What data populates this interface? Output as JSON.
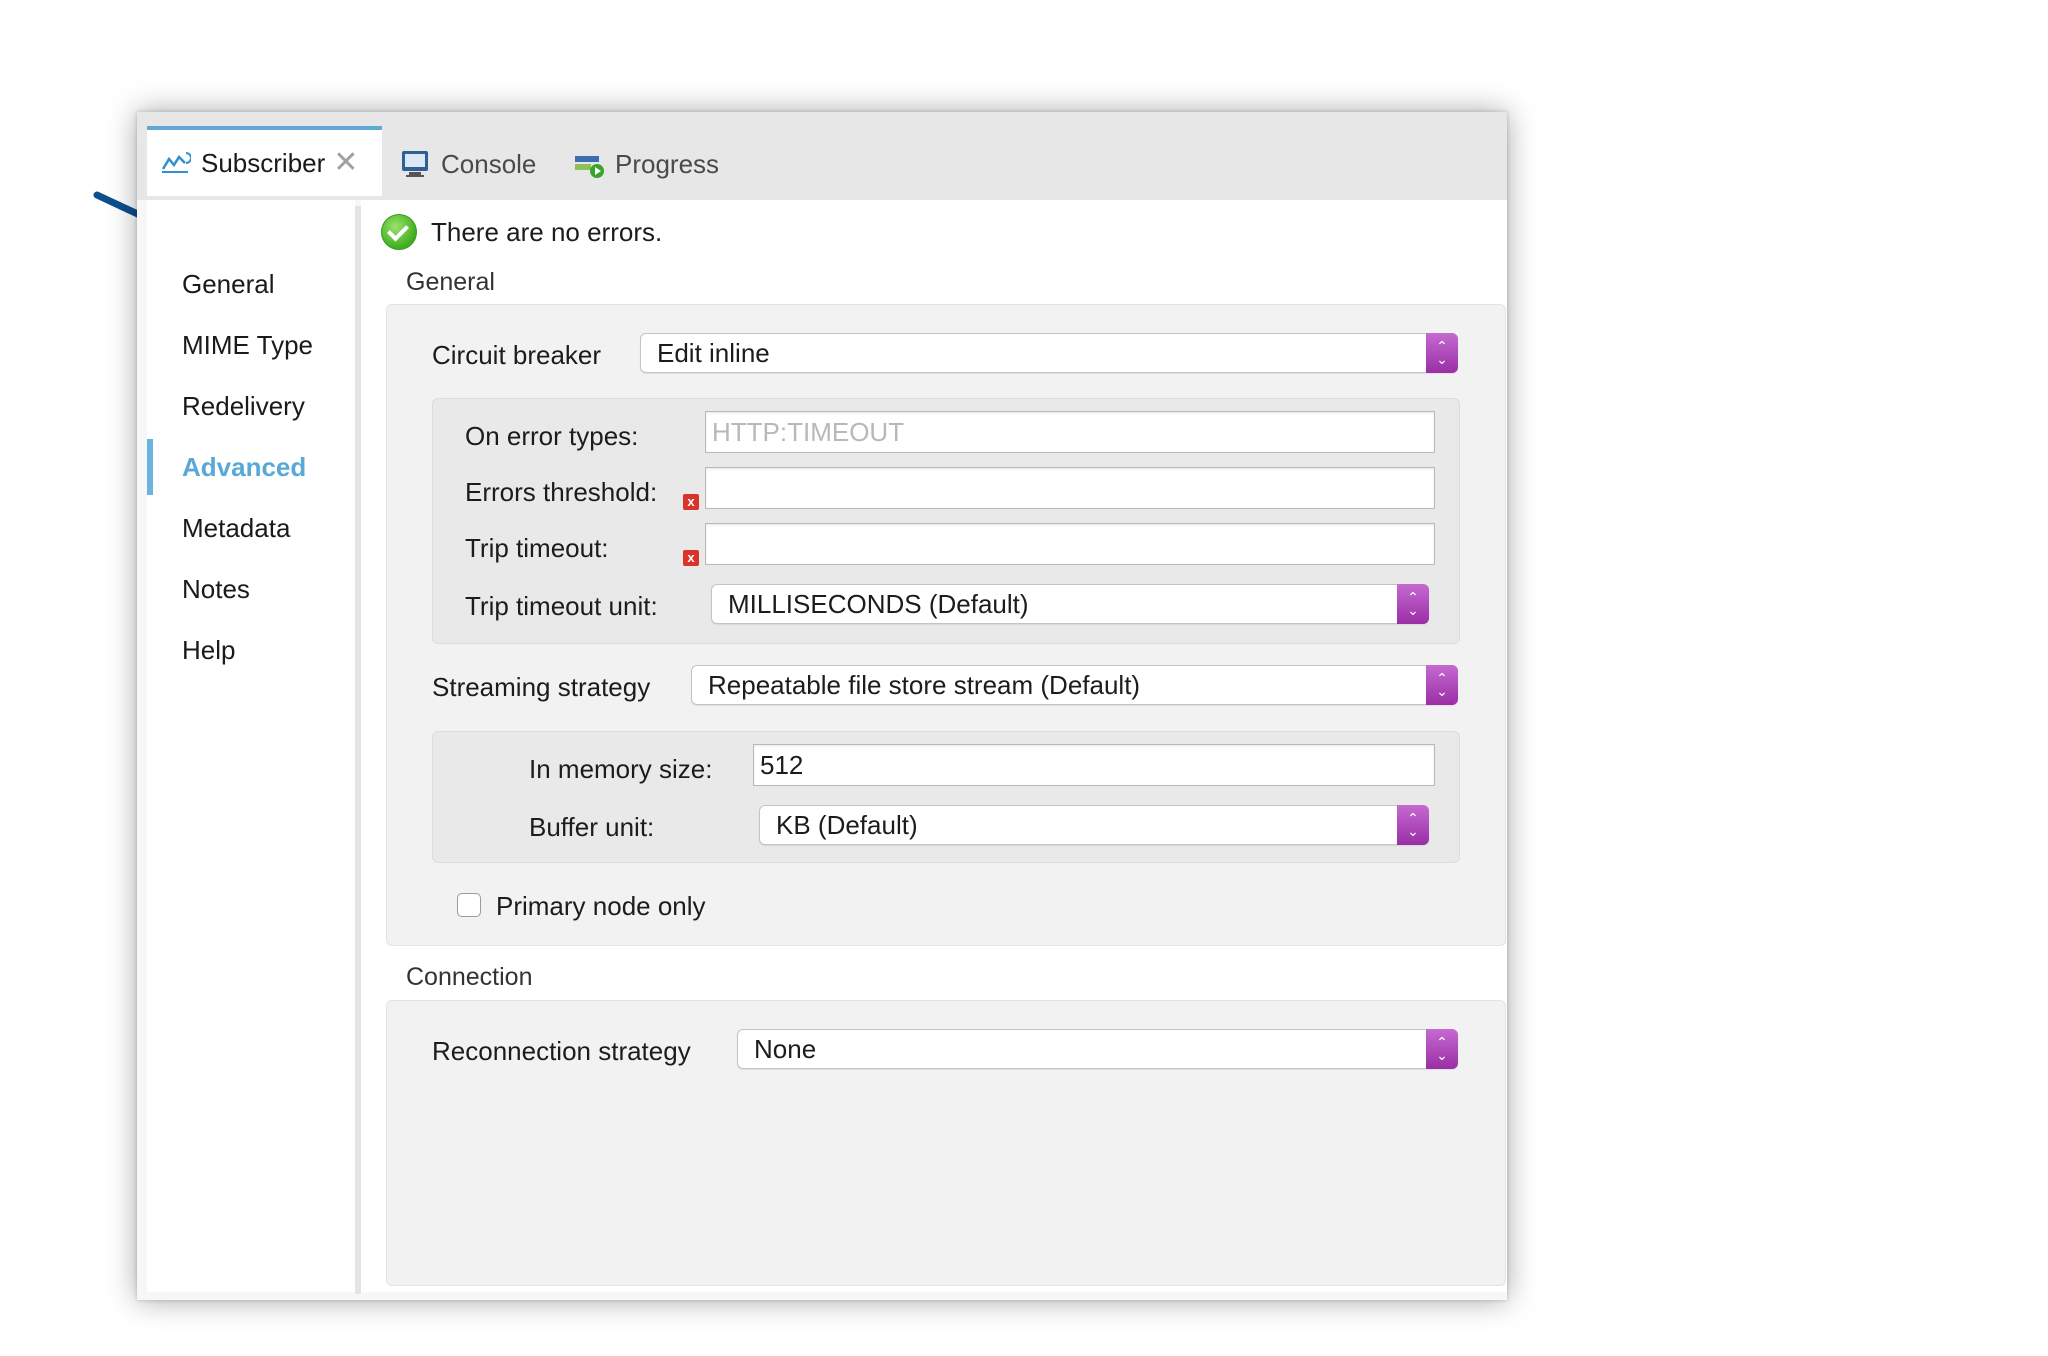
{
  "tabs": [
    {
      "label": "Subscriber",
      "active": true,
      "icon": "subscriber-icon"
    },
    {
      "label": "Console",
      "active": false,
      "icon": "console-icon"
    },
    {
      "label": "Progress",
      "active": false,
      "icon": "progress-icon"
    }
  ],
  "sidebar": {
    "items": [
      {
        "label": "General"
      },
      {
        "label": "MIME Type"
      },
      {
        "label": "Redelivery"
      },
      {
        "label": "Advanced",
        "active": true
      },
      {
        "label": "Metadata"
      },
      {
        "label": "Notes"
      },
      {
        "label": "Help"
      }
    ]
  },
  "status": {
    "text": "There are no errors.",
    "icon": "check-circle-icon"
  },
  "general": {
    "title": "General",
    "circuit_breaker": {
      "label": "Circuit breaker",
      "value": "Edit inline"
    },
    "on_error_types": {
      "label": "On error types:",
      "placeholder": "HTTP:TIMEOUT",
      "value": ""
    },
    "errors_threshold": {
      "label": "Errors threshold:",
      "value": ""
    },
    "trip_timeout": {
      "label": "Trip timeout:",
      "value": ""
    },
    "trip_timeout_unit": {
      "label": "Trip timeout unit:",
      "value": "MILLISECONDS (Default)"
    },
    "streaming_strategy": {
      "label": "Streaming strategy",
      "value": "Repeatable file store stream (Default)"
    },
    "in_memory_size": {
      "label": "In memory size:",
      "value": "512"
    },
    "buffer_unit": {
      "label": "Buffer unit:",
      "value": "KB (Default)"
    },
    "primary_node_only": {
      "label": "Primary node only",
      "checked": false
    }
  },
  "connection": {
    "title": "Connection",
    "reconnection_strategy": {
      "label": "Reconnection strategy",
      "value": "None"
    }
  },
  "colors": {
    "accent_blue": "#5aa8d6",
    "stepper_purple": "#b04ab9",
    "error_red": "#d9342b",
    "arrow_blue": "#0d4f8b"
  }
}
